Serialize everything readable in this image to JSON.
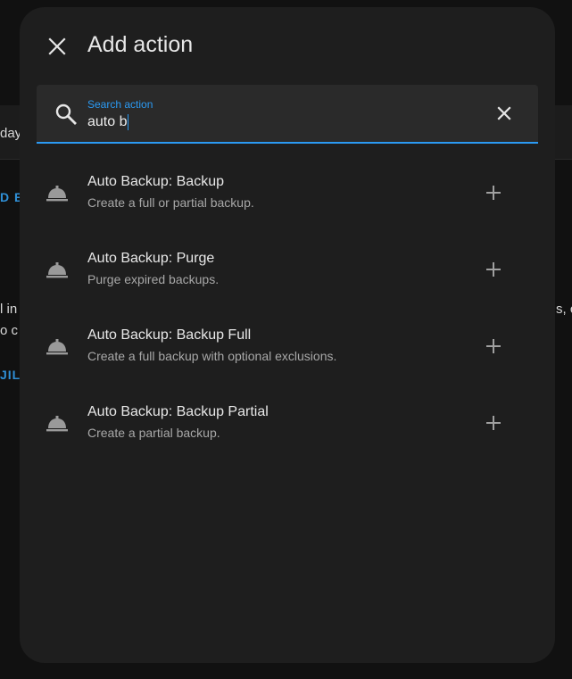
{
  "background": {
    "text_day": "day",
    "text_link1": "D BU",
    "text_fragment1": "l in",
    "text_fragment2": "o c",
    "text_link2": "JILD",
    "text_fragment3": "s, c"
  },
  "dialog": {
    "title": "Add action",
    "close_icon": "close-icon"
  },
  "search": {
    "label": "Search action",
    "value": "auto b",
    "accent_color": "#2b9af3"
  },
  "actions": [
    {
      "title": "Auto Backup: Backup",
      "description": "Create a full or partial backup.",
      "icon": "service-bell-icon"
    },
    {
      "title": "Auto Backup: Purge",
      "description": "Purge expired backups.",
      "icon": "service-bell-icon"
    },
    {
      "title": "Auto Backup: Backup Full",
      "description": "Create a full backup with optional exclusions.",
      "icon": "service-bell-icon"
    },
    {
      "title": "Auto Backup: Backup Partial",
      "description": "Create a partial backup.",
      "icon": "service-bell-icon"
    }
  ]
}
